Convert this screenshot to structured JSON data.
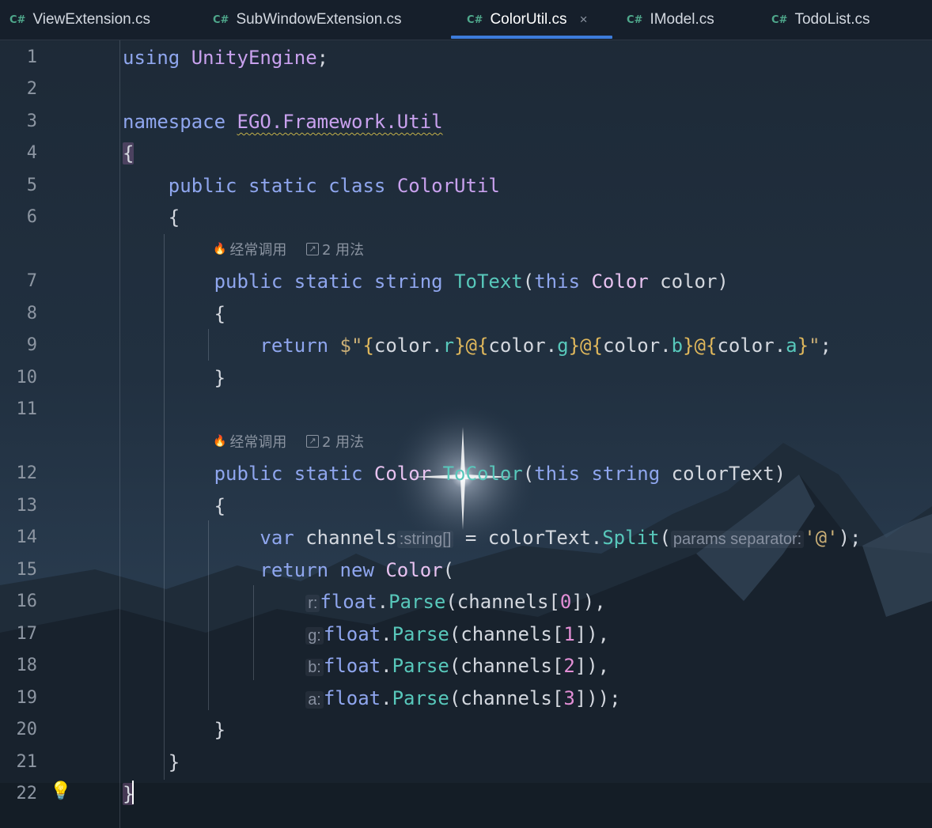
{
  "tabs": [
    {
      "badge": "C#",
      "label": "ViewExtension.cs"
    },
    {
      "badge": "C#",
      "label": "SubWindowExtension.cs"
    },
    {
      "badge": "C#",
      "label": "ColorUtil.cs",
      "active": true
    },
    {
      "badge": "C#",
      "label": "IModel.cs"
    },
    {
      "badge": "C#",
      "label": "TodoList.cs"
    }
  ],
  "tab_close_glyph": "×",
  "line_numbers": [
    "1",
    "2",
    "3",
    "4",
    "5",
    "6",
    "7",
    "8",
    "9",
    "10",
    "11",
    "12",
    "13",
    "14",
    "15",
    "16",
    "17",
    "18",
    "19",
    "20",
    "21",
    "22"
  ],
  "code": {
    "l1": {
      "kw": "using",
      "ns": "UnityEngine",
      "end": ";"
    },
    "l3": {
      "kw": "namespace",
      "ns": "EGO.Framework.Util"
    },
    "l4": {
      "text": "{"
    },
    "l5": {
      "mod1": "public",
      "mod2": "static",
      "mod3": "class",
      "name": "ColorUtil"
    },
    "l6": {
      "text": "{"
    },
    "l7": {
      "mod1": "public",
      "mod2": "static",
      "ret": "string",
      "name": "ToText",
      "open": "(",
      "this": "this",
      "ptype": "Color",
      "pname": "color",
      "close": ")"
    },
    "l8": {
      "text": "{"
    },
    "l9": {
      "kw": "return",
      "dollar": "$",
      "q1": "\"",
      "parts": [
        {
          "ob": "{",
          "var": "color.",
          "field": "r",
          "cb": "}",
          "sep": "@"
        },
        {
          "ob": "{",
          "var": "color.",
          "field": "g",
          "cb": "}",
          "sep": "@"
        },
        {
          "ob": "{",
          "var": "color.",
          "field": "b",
          "cb": "}",
          "sep": "@"
        },
        {
          "ob": "{",
          "var": "color.",
          "field": "a",
          "cb": "}",
          "sep": ""
        }
      ],
      "q2": "\"",
      "end": ";"
    },
    "l10": {
      "text": "}"
    },
    "l12": {
      "mod1": "public",
      "mod2": "static",
      "ret": "Color",
      "name": "ToColor",
      "open": "(",
      "this": "this",
      "ptype": "string",
      "pname": "colorText",
      "close": ")"
    },
    "l13": {
      "text": "{"
    },
    "l14": {
      "kw": "var",
      "name": "channels",
      "type_hint": ":string[]",
      "assign": " = colorText.",
      "fn": "Split",
      "open": "(",
      "param_hint": "params separator:",
      "literal": "'@'",
      "close": ");"
    },
    "l15": {
      "kw1": "return",
      "kw2": "new",
      "type": "Color",
      "open": "("
    },
    "args": [
      {
        "hint": "r:",
        "type": "float",
        "dot": ".",
        "fn": "Parse",
        "pre": "(channels[",
        "idx": "0",
        "post": "]),"
      },
      {
        "hint": "g:",
        "type": "float",
        "dot": ".",
        "fn": "Parse",
        "pre": "(channels[",
        "idx": "1",
        "post": "]),"
      },
      {
        "hint": "b:",
        "type": "float",
        "dot": ".",
        "fn": "Parse",
        "pre": "(channels[",
        "idx": "2",
        "post": "]),"
      },
      {
        "hint": "a:",
        "type": "float",
        "dot": ".",
        "fn": "Parse",
        "pre": "(channels[",
        "idx": "3",
        "post": "]));"
      }
    ],
    "l20": {
      "text": "}"
    },
    "l21": {
      "text": "}"
    },
    "l22": {
      "text": "}"
    }
  },
  "code_vision": [
    {
      "frequent": "经常调用",
      "usages": "2 用法"
    },
    {
      "frequent": "经常调用",
      "usages": "2 用法"
    }
  ],
  "icons": {
    "frequent": "flame-icon",
    "usages": "usages-arrow-icon",
    "bulb": "lightbulb-icon",
    "close": "close-icon"
  },
  "colors": {
    "keyword": "#8fa6ee",
    "type": "#c9a1ee",
    "function": "#58c8bb",
    "string": "#c9ae76",
    "accent": "#3d7cdb"
  }
}
